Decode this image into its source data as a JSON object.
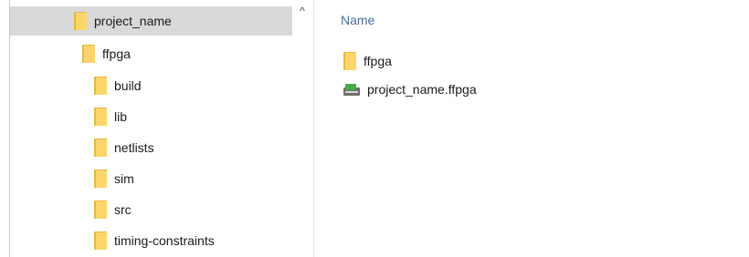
{
  "navigation_pane": {
    "items": [
      {
        "label": "project_name",
        "selected": true
      },
      {
        "label": "ffpga"
      },
      {
        "label": "build"
      },
      {
        "label": "lib"
      },
      {
        "label": "netlists"
      },
      {
        "label": "sim"
      },
      {
        "label": "src"
      },
      {
        "label": "timing-constraints"
      }
    ],
    "scroll_up_glyph": "^"
  },
  "content_pane": {
    "column_header": "Name",
    "files": [
      {
        "name": "ffpga",
        "icon": "folder-icon"
      },
      {
        "name": "project_name.ffpga",
        "icon": "ffpga-file-icon"
      }
    ]
  },
  "colors": {
    "folder": "#fdd66b",
    "selection": "#d9d9d9",
    "header_text": "#4a6f97"
  }
}
